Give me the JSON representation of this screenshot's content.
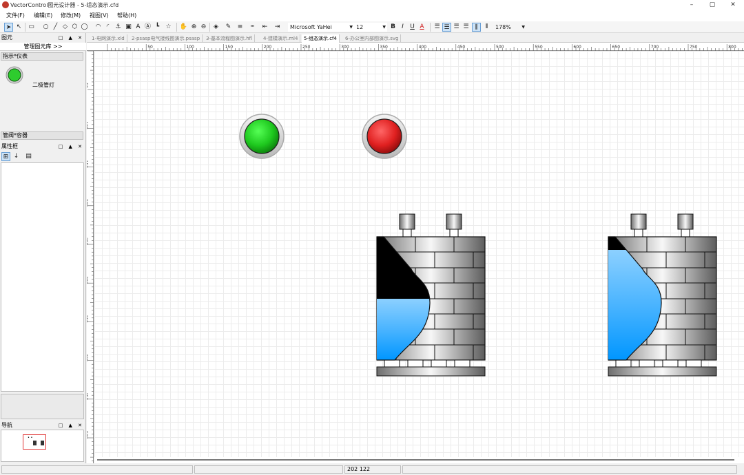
{
  "window": {
    "title": "VectorControl图元设计器 - 5-组态演示.cfd",
    "minimize": "–",
    "maximize": "▢",
    "close": "✕"
  },
  "menu": [
    "文件(F)",
    "编辑(E)",
    "修改(M)",
    "视图(V)",
    "帮助(H)"
  ],
  "toolbar": {
    "font_name": "Microsoft YaHei",
    "font_size": "12",
    "zoom": "178%",
    "bold": "B",
    "italic": "I",
    "underline": "U",
    "text_color": "A",
    "text_tool": "A"
  },
  "left": {
    "primitives_title": "图元",
    "library_tab": "管理图元库 >>",
    "group1": "指示*仪表",
    "item1": "二极管灯",
    "group2": "管阀*容器",
    "props_title": "属性框",
    "nav_title": "导航",
    "panel_controls": "□ ▲ ✕"
  },
  "tabs": [
    "1-电网演示.xld",
    "2-psasp电气接线图演示.psasp",
    "3-基本流程图演示.hfl",
    "4-建模演示.ml4",
    "5-组态演示.cf4",
    "6-办公室内部图演示.svg"
  ],
  "active_tab_index": 4,
  "ruler": {
    "h_labels": [
      "50",
      "100",
      "150",
      "200",
      "250",
      "300",
      "350",
      "400",
      "450",
      "500",
      "550",
      "600",
      "650",
      "700",
      "750",
      "800"
    ],
    "v_labels": [
      "50",
      "100",
      "150",
      "200",
      "250",
      "300",
      "350",
      "400",
      "450",
      "500"
    ]
  },
  "canvas": {
    "lamps": [
      {
        "state": "on",
        "color": "#1ec81e"
      },
      {
        "state": "alarm",
        "color": "#e02020"
      }
    ],
    "tank_fill_levels": [
      0.5,
      0.9
    ]
  },
  "status": {
    "coords": "202 122"
  },
  "colors": {
    "accent": "#0078d7",
    "lamp_green": "#1ec81e",
    "lamp_red": "#e02020",
    "liquid": "#0a9cff"
  }
}
